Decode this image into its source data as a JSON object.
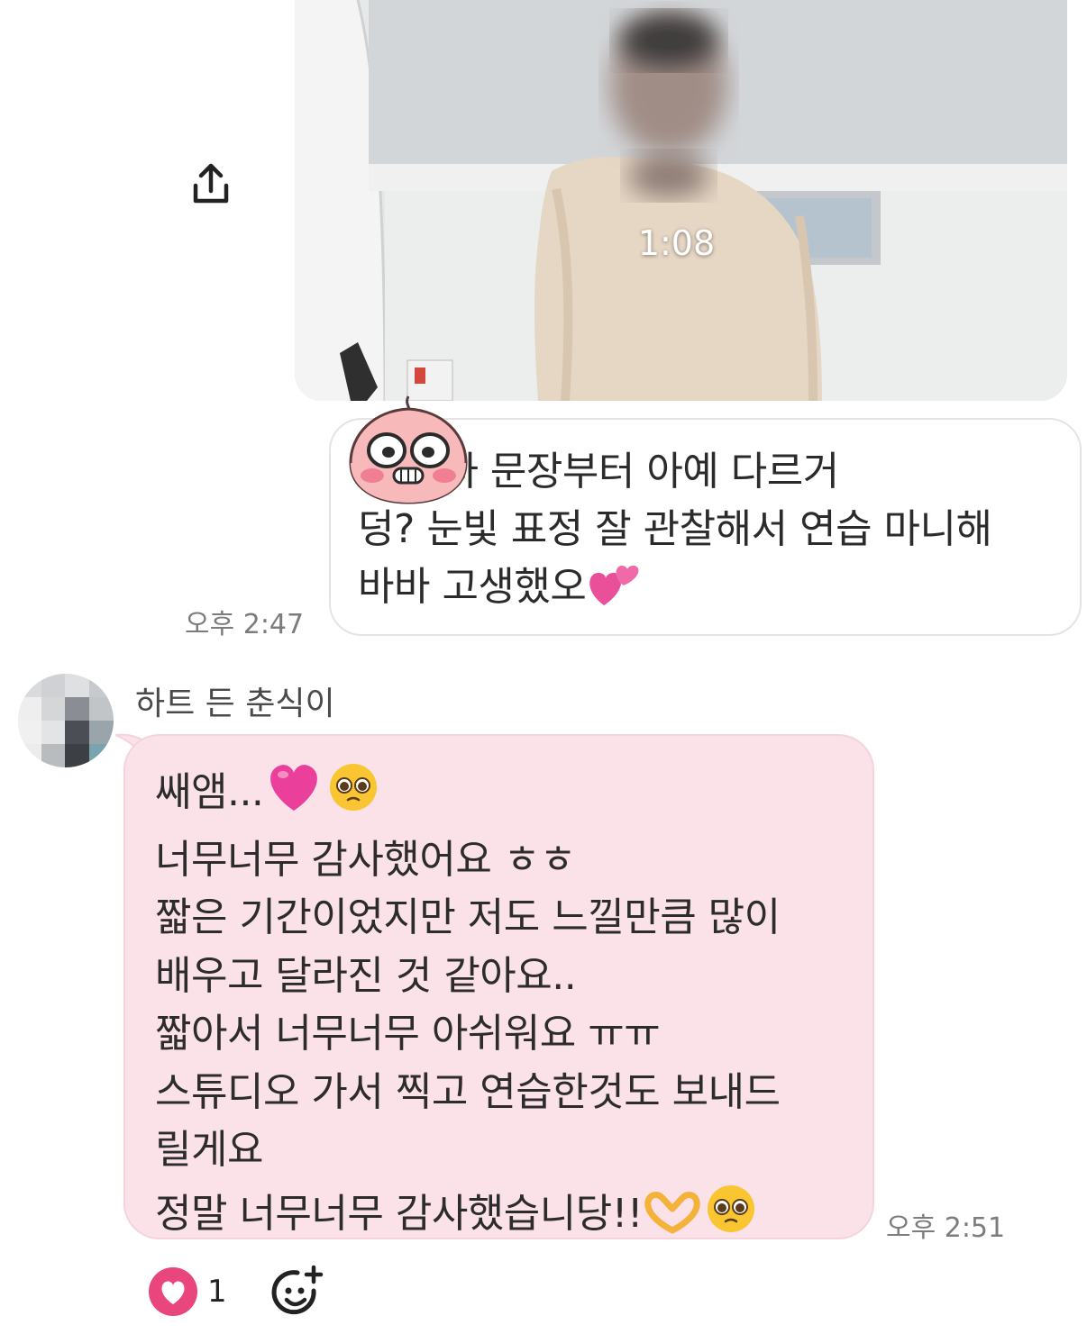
{
  "video": {
    "duration": "1:08"
  },
  "outgoing_message": {
    "text_lines": [
      "    첫 인사 문장부터 아예 다르거",
      "덩? 눈빛 표정 잘 관찰해서 연습 마니해",
      "바바 고생했오"
    ],
    "time": "오후 2:47"
  },
  "incoming_message": {
    "sender": "하트 든 춘식이",
    "lines": [
      "쌔앰...",
      "너무너무 감사했어요 ㅎㅎ",
      "짧은 기간이었지만 저도 느낄만큼 많이",
      "배우고 달라진 것 같아요..",
      "짧아서 너무너무 아쉬워요 ㅠㅠ",
      "스튜디오 가서 찍고 연습한것도 보내드",
      "릴게요",
      "정말 너무너무 감사했습니당!!"
    ],
    "time": "오후 2:51"
  },
  "reactions": {
    "heart_count": "1"
  },
  "colors": {
    "incoming_bubble": "#fbe1e8",
    "heart": "#e8467c"
  },
  "icons": {
    "share": "share-icon",
    "heart": "heart-icon",
    "add_reaction": "add-reaction-icon"
  }
}
